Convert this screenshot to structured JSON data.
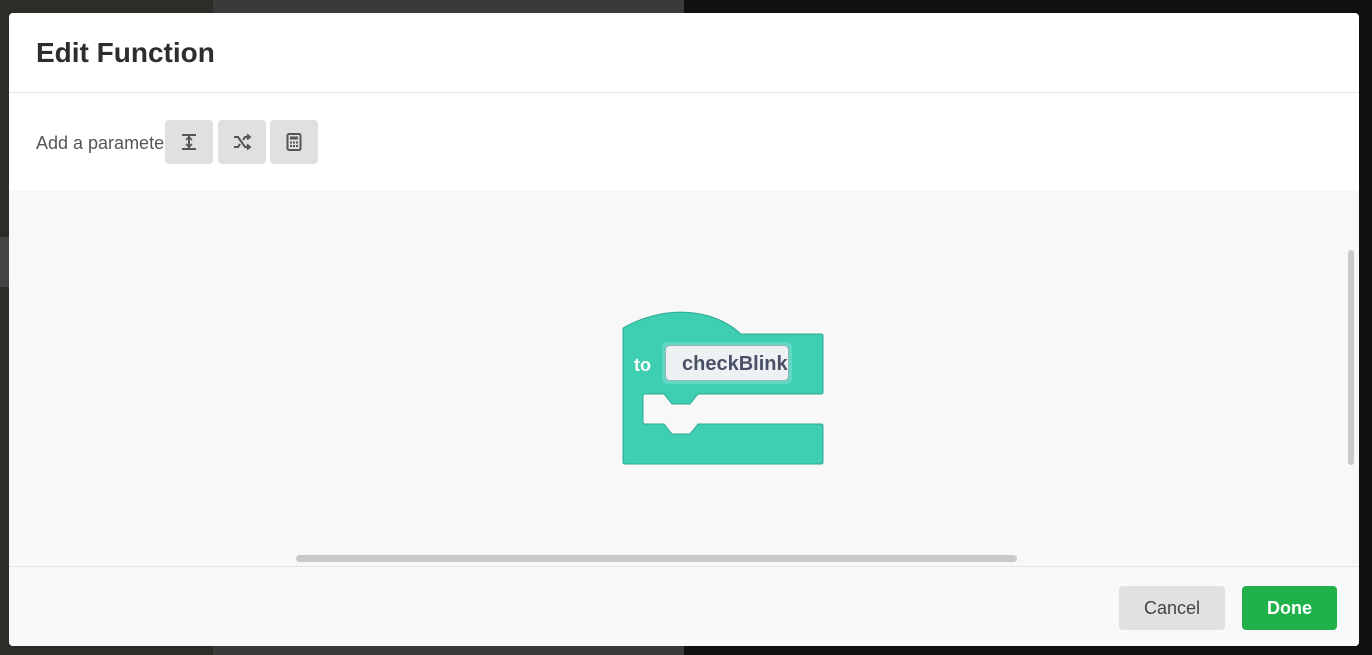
{
  "dialog": {
    "title": "Edit Function"
  },
  "parameters": {
    "label": "Add a parameter",
    "buttons": [
      {
        "icon": "text-parameter-icon"
      },
      {
        "icon": "boolean-parameter-icon"
      },
      {
        "icon": "number-parameter-icon"
      }
    ]
  },
  "block": {
    "keyword": "to",
    "function_name": "checkBlink",
    "color": "#3ecfb2"
  },
  "footer": {
    "cancel_label": "Cancel",
    "done_label": "Done",
    "done_color": "#21b14a"
  }
}
